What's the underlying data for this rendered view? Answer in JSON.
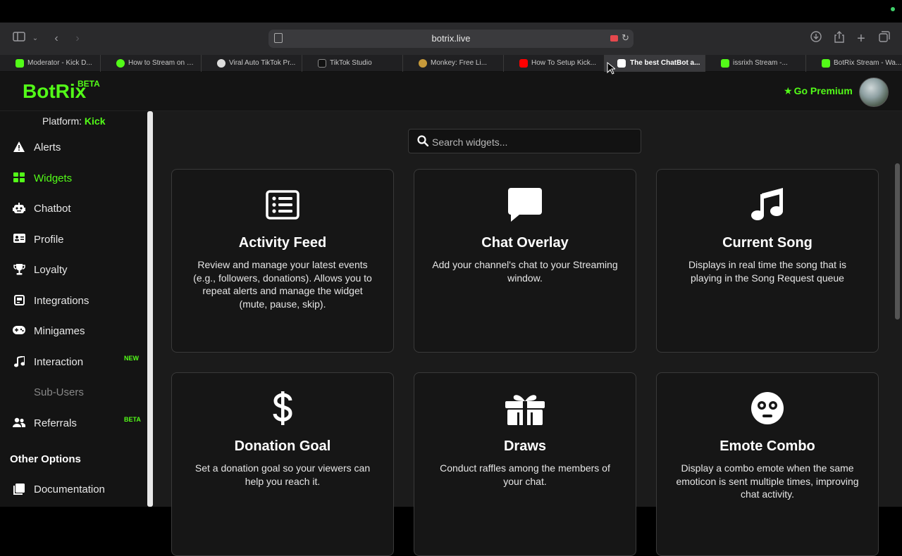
{
  "browser": {
    "url": "botrix.live",
    "tabs": [
      {
        "label": "Moderator - Kick D...",
        "color": "#53fc18"
      },
      {
        "label": "How to Stream on K...",
        "color": "#53fc18"
      },
      {
        "label": "Viral Auto TikTok Pr...",
        "color": "#dddddd"
      },
      {
        "label": "TikTok Studio",
        "color": "#111111"
      },
      {
        "label": "Monkey: Free Li...",
        "color": "#c79a3a"
      },
      {
        "label": "How To Setup Kick...",
        "color": "#ff0000"
      },
      {
        "label": "The best ChatBot a...",
        "color": "#ffffff"
      },
      {
        "label": "issrixh Stream -...",
        "color": "#53fc18"
      },
      {
        "label": "BotRix Stream - Wa...",
        "color": "#53fc18"
      }
    ]
  },
  "header": {
    "logo": "BotRix",
    "logo_badge": "BETA",
    "premium_label": "Go Premium"
  },
  "sidebar": {
    "platform_label": "Platform:",
    "platform_value": "Kick",
    "items": [
      {
        "label": "Alerts",
        "icon": "warning-icon"
      },
      {
        "label": "Widgets",
        "icon": "grid-icon"
      },
      {
        "label": "Chatbot",
        "icon": "robot-icon"
      },
      {
        "label": "Profile",
        "icon": "id-card-icon"
      },
      {
        "label": "Loyalty",
        "icon": "trophy-icon"
      },
      {
        "label": "Integrations",
        "icon": "integrations-icon"
      },
      {
        "label": "Minigames",
        "icon": "gamepad-icon"
      },
      {
        "label": "Interaction",
        "icon": "music-icon",
        "badge": "NEW"
      },
      {
        "label": "Sub-Users",
        "icon": "",
        "disabled": true
      },
      {
        "label": "Referrals",
        "icon": "users-icon",
        "badge": "BETA"
      }
    ],
    "other_title": "Other Options",
    "other_items": [
      {
        "label": "Documentation",
        "icon": "book-icon"
      }
    ]
  },
  "search": {
    "placeholder": "Search widgets..."
  },
  "widgets": [
    {
      "title": "Activity Feed",
      "desc": "Review and manage your latest events (e.g., followers, donations). Allows you to repeat alerts and manage the widget (mute, pause, skip).",
      "icon": "list-icon"
    },
    {
      "title": "Chat Overlay",
      "desc": "Add your channel's chat to your Streaming window.",
      "icon": "chat-bubble-icon"
    },
    {
      "title": "Current Song",
      "desc": "Displays in real time the song that is playing in the Song Request queue",
      "icon": "music-note-icon"
    },
    {
      "title": "Donation Goal",
      "desc": "Set a donation goal so your viewers can help you reach it.",
      "icon": "dollar-icon"
    },
    {
      "title": "Draws",
      "desc": "Conduct raffles among the members of your chat.",
      "icon": "gift-icon"
    },
    {
      "title": "Emote Combo",
      "desc": "Display a combo emote when the same emoticon is sent multiple times, improving chat activity.",
      "icon": "surprised-face-icon"
    }
  ],
  "colors": {
    "accent": "#53fc18",
    "background": "#1b1b1b",
    "card": "#161616"
  }
}
